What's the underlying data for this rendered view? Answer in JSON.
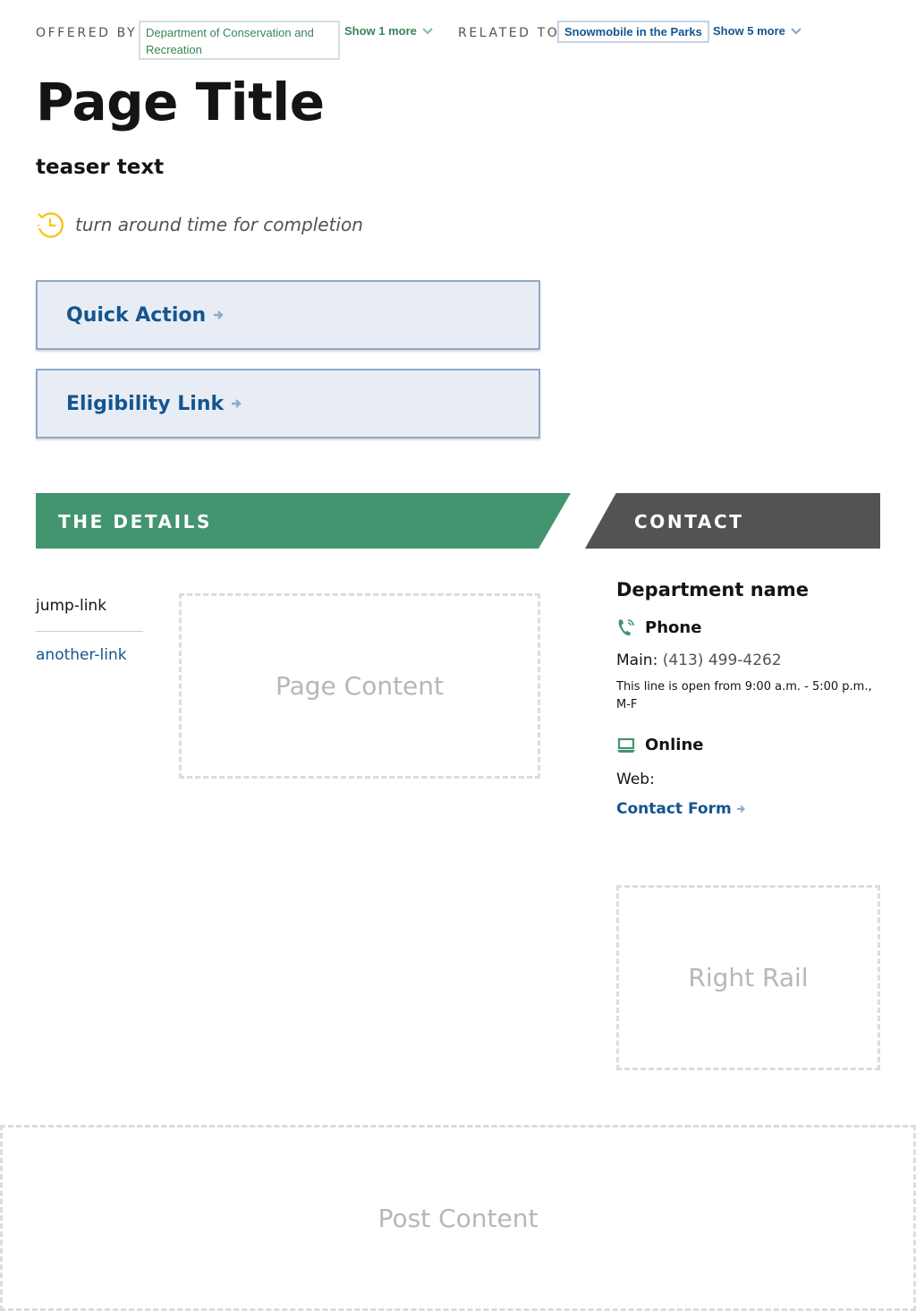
{
  "meta": {
    "offered_by_label": "OFFERED BY",
    "offered_by_org": "Department of Conservation and Recreation",
    "offered_show_more": "Show 1 more",
    "related_to_label": "RELATED TO",
    "related_to_item": "Snowmobile in the Parks",
    "related_show_more": "Show 5 more"
  },
  "page": {
    "title": "Page Title",
    "teaser": "teaser text",
    "turnaround": "turn around time for completion"
  },
  "actions": {
    "quick_action": "Quick Action",
    "eligibility_link": "Eligibility Link"
  },
  "sections": {
    "details": "THE DETAILS",
    "contact": "CONTACT"
  },
  "jump_links": {
    "first": "jump-link",
    "second": "another-link"
  },
  "placeholders": {
    "page_content": "Page Content",
    "right_rail": "Right Rail",
    "post_content": "Post Content"
  },
  "contact": {
    "department_name": "Department name",
    "phone_heading": "Phone",
    "main_label": "Main:",
    "main_number": "(413) 499-4262",
    "hours": "This line is open from 9:00 a.m. - 5:00 p.m., M-F",
    "online_heading": "Online",
    "web_label": "Web:",
    "contact_form": "Contact Form"
  },
  "colors": {
    "brand_green": "#43956f",
    "brand_blue": "#14558f",
    "dark_gray": "#535353",
    "turnaround_icon": "#f6c51b"
  }
}
